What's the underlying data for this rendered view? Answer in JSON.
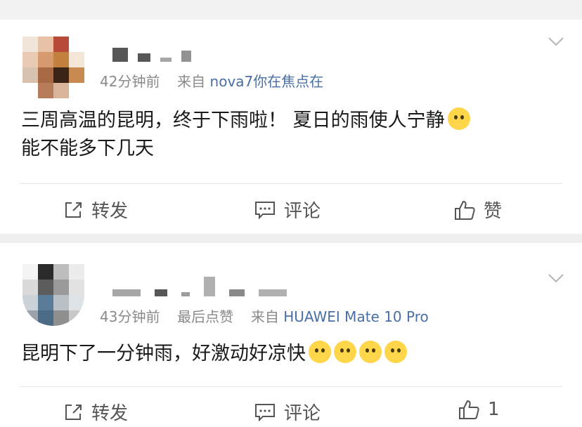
{
  "posts": [
    {
      "meta": {
        "time": "42分钟前",
        "from_label": "来自",
        "source": "nova7你在焦点在"
      },
      "text": "三周高温的昆明，终于下雨啦！ 夏日的雨使人宁静",
      "text2": "能不能多下几天",
      "actions": {
        "repost": "转发",
        "comment": "评论",
        "like": "赞"
      }
    },
    {
      "meta": {
        "time": "43分钟前",
        "liked": "最后点赞",
        "from_label": "来自",
        "source": "HUAWEI Mate 10 Pro"
      },
      "text": "昆明下了一分钟雨，好激动好凉快",
      "actions": {
        "repost": "转发",
        "comment": "评论",
        "like": "1"
      }
    }
  ],
  "icons": [
    "edit-icon",
    "comment-icon",
    "thumbs-up-icon",
    "chevron-down-icon",
    "emoji-icon"
  ],
  "colors": {
    "source_link": "#4a6fa5",
    "meta_gray": "#8a8a8a",
    "background": "#f2f2f2"
  }
}
